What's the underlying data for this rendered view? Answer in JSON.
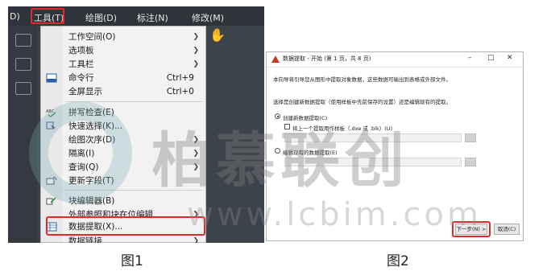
{
  "figure1": {
    "menubar": [
      {
        "label": "D)"
      },
      {
        "label": "工具(T)",
        "active": true
      },
      {
        "label": "绘图(D)"
      },
      {
        "label": "标注(N)"
      },
      {
        "label": "修改(M)"
      }
    ],
    "menu_items": [
      {
        "label": "工作空间(O)",
        "submenu": true,
        "shortcut": ""
      },
      {
        "label": "选项板",
        "submenu": true,
        "shortcut": ""
      },
      {
        "label": "工具栏",
        "submenu": true,
        "shortcut": ""
      },
      {
        "label": "命令行",
        "submenu": false,
        "shortcut": "Ctrl+9",
        "icon": "command-line-icon"
      },
      {
        "label": "全屏显示",
        "submenu": false,
        "shortcut": "Ctrl+0"
      },
      {
        "label": "拼写检查(E)",
        "submenu": false,
        "shortcut": "",
        "icon": "spell-check-icon"
      },
      {
        "label": "快速选择(K)...",
        "submenu": false,
        "shortcut": "",
        "icon": "quick-select-icon"
      },
      {
        "label": "绘图次序(D)",
        "submenu": true,
        "shortcut": ""
      },
      {
        "label": "隔离(I)",
        "submenu": true,
        "shortcut": ""
      },
      {
        "label": "查询(Q)",
        "submenu": true,
        "shortcut": ""
      },
      {
        "label": "更新字段(T)",
        "submenu": false,
        "shortcut": "",
        "icon": "update-fields-icon"
      },
      {
        "label": "块编辑器(B)",
        "submenu": false,
        "shortcut": "",
        "icon": "block-editor-icon"
      },
      {
        "label": "外部参照和块在位编辑",
        "submenu": true,
        "shortcut": ""
      },
      {
        "label": "数据提取(X)...",
        "submenu": false,
        "shortcut": "",
        "icon": "data-extraction-icon",
        "highlighted": true
      },
      {
        "label": "数据链接",
        "submenu": true,
        "shortcut": ""
      }
    ],
    "caption": "图1"
  },
  "figure2": {
    "title": "数据提取 - 开始 (第 1 页，共 8 页)",
    "window_controls": {
      "minimize": "–",
      "maximize": "□",
      "close": "✕"
    },
    "intro": "本向导将引导您从图形中提取对象数据，这些数据可输出到表格或外部文件。",
    "question": "选择是创建新数据提取（使用样板中先前保存的设置）还是编辑现有的提取。",
    "option_new": "创建新数据提取(C)",
    "option_template": "将上一个提取用作样板（.dxe 或 .blk）(U)",
    "option_edit": "编辑现有的数据提取(E)",
    "next_button": "下一步(N) >",
    "cancel_button": "取消(C)",
    "caption": "图2"
  },
  "watermark": {
    "name": "柏慕联创",
    "url": "www.lcbim.com"
  },
  "colors": {
    "highlight": "#e02a2a",
    "dark_bg": "#3a3f47",
    "menu_bg": "#f2f2f2"
  }
}
